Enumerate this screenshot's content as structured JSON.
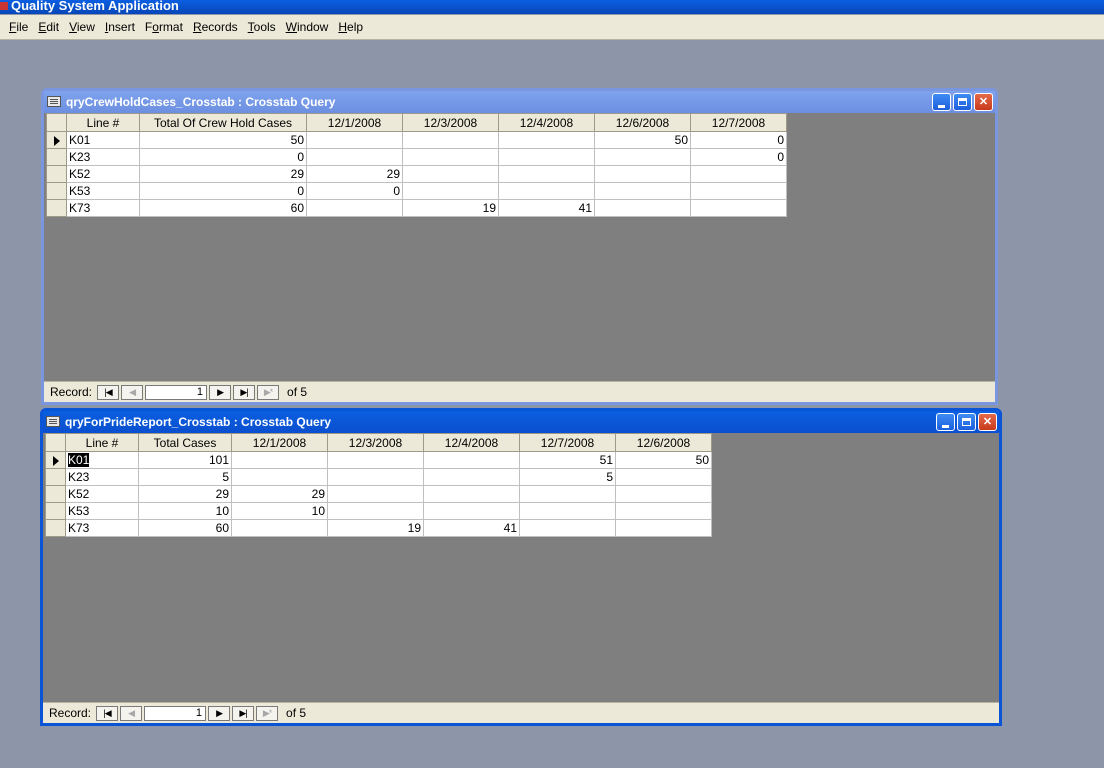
{
  "app": {
    "title": "Quality System Application"
  },
  "menu": [
    {
      "pre": "",
      "key": "F",
      "post": "ile"
    },
    {
      "pre": "",
      "key": "E",
      "post": "dit"
    },
    {
      "pre": "",
      "key": "V",
      "post": "iew"
    },
    {
      "pre": "",
      "key": "I",
      "post": "nsert"
    },
    {
      "pre": "F",
      "key": "o",
      "post": "rmat"
    },
    {
      "pre": "",
      "key": "R",
      "post": "ecords"
    },
    {
      "pre": "",
      "key": "T",
      "post": "ools"
    },
    {
      "pre": "",
      "key": "W",
      "post": "indow"
    },
    {
      "pre": "",
      "key": "H",
      "post": "elp"
    }
  ],
  "windows": [
    {
      "title": "qryCrewHoldCases_Crosstab : Crosstab Query",
      "active": false,
      "columns": [
        "Line #",
        "Total Of Crew Hold Cases",
        "12/1/2008",
        "12/3/2008",
        "12/4/2008",
        "12/6/2008",
        "12/7/2008"
      ],
      "rows": [
        [
          "K01",
          "50",
          "",
          "",
          "",
          "50",
          "0"
        ],
        [
          "K23",
          "0",
          "",
          "",
          "",
          "",
          "0"
        ],
        [
          "K52",
          "29",
          "29",
          "",
          "",
          "",
          ""
        ],
        [
          "K53",
          "0",
          "0",
          "",
          "",
          "",
          ""
        ],
        [
          "K73",
          "60",
          "",
          "19",
          "41",
          "",
          ""
        ]
      ],
      "current_row": 0,
      "nav": {
        "label": "Record:",
        "current": "1",
        "of_text": "of 5"
      }
    },
    {
      "title": "qryForPrideReport_Crosstab : Crosstab Query",
      "active": true,
      "columns": [
        "Line #",
        "Total Cases",
        "12/1/2008",
        "12/3/2008",
        "12/4/2008",
        "12/7/2008",
        "12/6/2008"
      ],
      "rows": [
        [
          "K01",
          "101",
          "",
          "",
          "",
          "51",
          "50"
        ],
        [
          "K23",
          "5",
          "",
          "",
          "",
          "5",
          ""
        ],
        [
          "K52",
          "29",
          "29",
          "",
          "",
          "",
          ""
        ],
        [
          "K53",
          "10",
          "10",
          "",
          "",
          "",
          ""
        ],
        [
          "K73",
          "60",
          "",
          "19",
          "41",
          "",
          ""
        ]
      ],
      "current_row": 0,
      "nav": {
        "label": "Record:",
        "current": "1",
        "of_text": "of 5"
      }
    }
  ],
  "icons": {
    "first": "first-record-icon",
    "prev": "previous-record-icon",
    "next": "next-record-icon",
    "last": "last-record-icon",
    "new": "new-record-icon"
  }
}
